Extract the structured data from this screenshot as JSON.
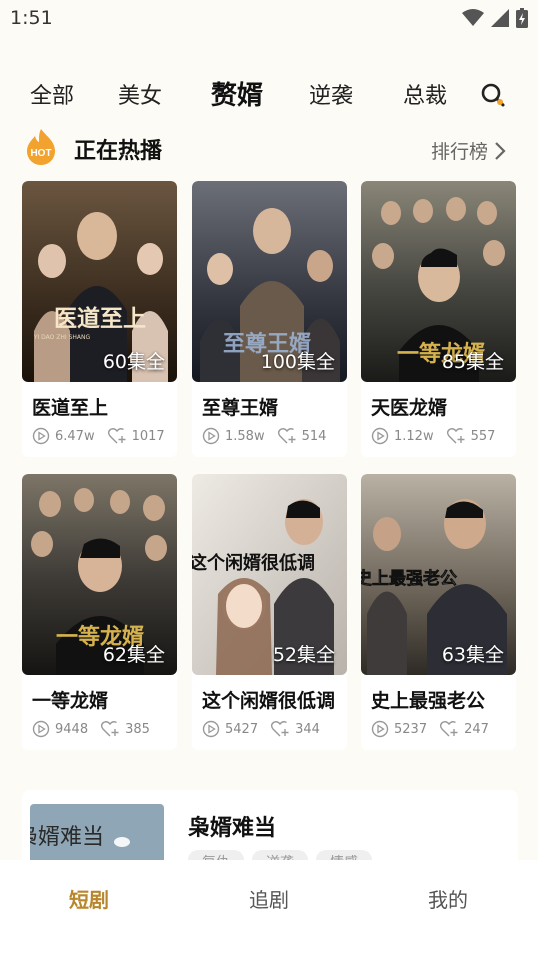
{
  "status": {
    "time": "1:51"
  },
  "tabs": [
    {
      "label": "全部"
    },
    {
      "label": "美女"
    },
    {
      "label": "赘婿",
      "active": true
    },
    {
      "label": "逆袭"
    },
    {
      "label": "总裁"
    }
  ],
  "section": {
    "hot_badge": "HOT",
    "title": "正在热播",
    "rank_link": "排行榜"
  },
  "cards": [
    {
      "title": "医道至上",
      "episodes": "60集全",
      "plays": "6.47w",
      "likes": "1017",
      "poster_text": "医道至上",
      "poster_sub": "YI DAO ZHI SHANG"
    },
    {
      "title": "至尊王婿",
      "episodes": "100集全",
      "plays": "1.58w",
      "likes": "514",
      "poster_text": "至尊王婿",
      "poster_sub": ""
    },
    {
      "title": "天医龙婿",
      "episodes": "85集全",
      "plays": "1.12w",
      "likes": "557",
      "poster_text": "一等龙婿",
      "poster_sub": ""
    },
    {
      "title": "一等龙婿",
      "episodes": "62集全",
      "plays": "9448",
      "likes": "385",
      "poster_text": "一等龙婿",
      "poster_sub": ""
    },
    {
      "title": "这个闲婿很低调",
      "episodes": "52集全",
      "plays": "5427",
      "likes": "344",
      "poster_text": "这个闲婿很低调",
      "poster_sub": ""
    },
    {
      "title": "史上最强老公",
      "episodes": "63集全",
      "plays": "5237",
      "likes": "247",
      "poster_text": "史上最强老公",
      "poster_sub": ""
    }
  ],
  "list": [
    {
      "title": "枭婿难当",
      "poster_text": "枭婿难当",
      "tags": [
        "复仇",
        "逆袭",
        "情感"
      ]
    }
  ],
  "bottom_nav": [
    {
      "label": "短剧",
      "active": true
    },
    {
      "label": "追剧"
    },
    {
      "label": "我的"
    }
  ],
  "colors": {
    "accent": "#b8862c",
    "hot": "#f2a22e",
    "background": "#fcfbf5"
  }
}
